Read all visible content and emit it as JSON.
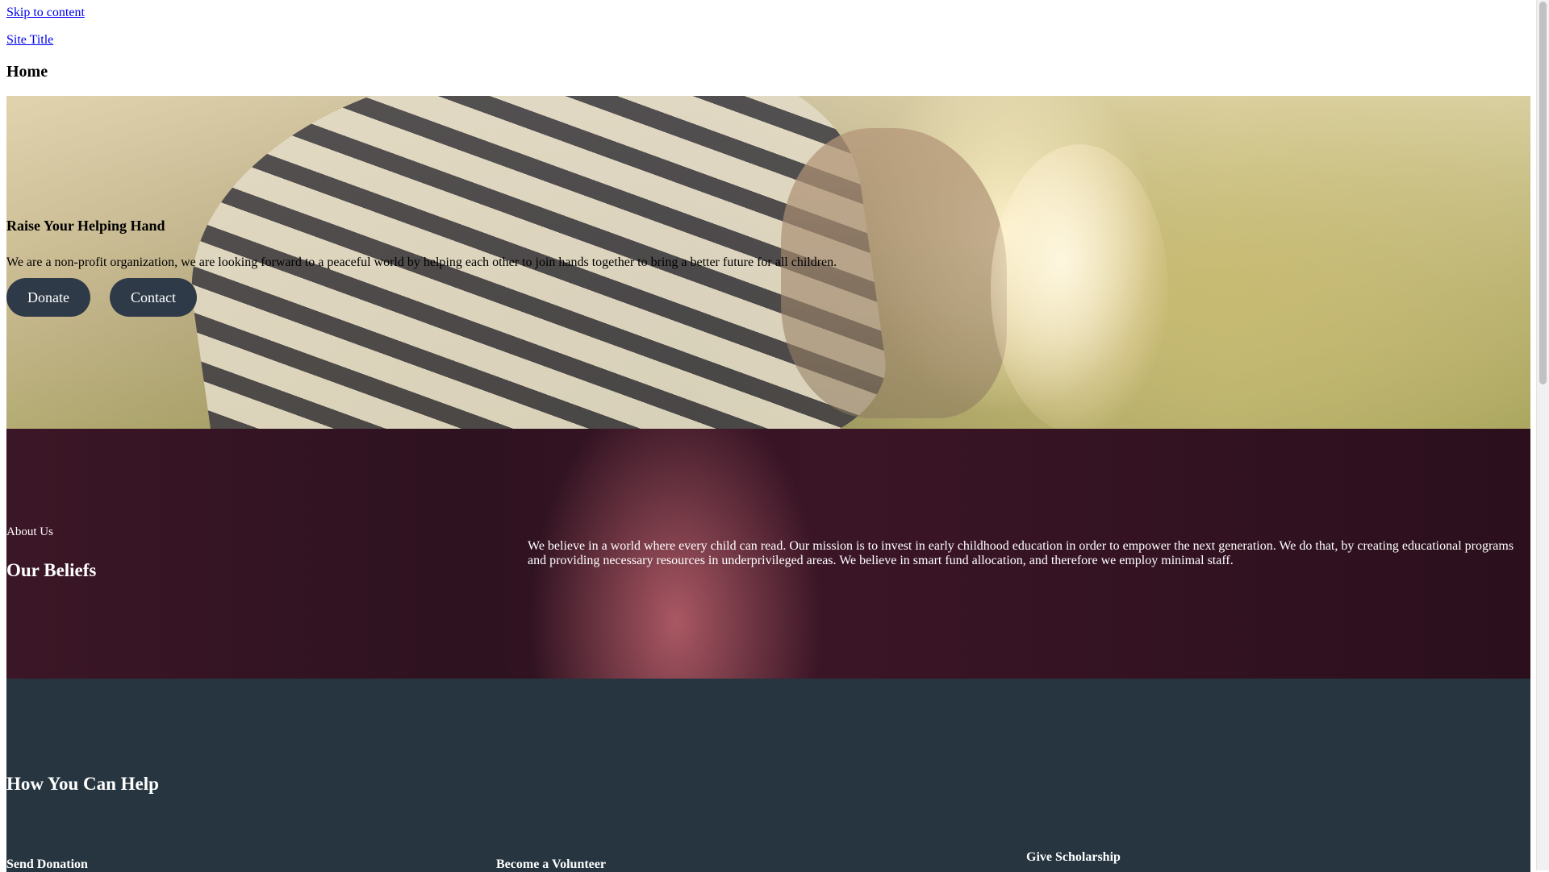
{
  "header": {
    "skip_link": "Skip to content",
    "site_title": "Site Title",
    "page_title": "Home"
  },
  "hero": {
    "heading": "Raise Your Helping Hand",
    "text": "We are a non-profit organization, we are looking forward to a peaceful world by helping each other to join hands together to bring a better future for all children.",
    "donate_label": "Donate",
    "contact_label": "Contact"
  },
  "beliefs": {
    "eyebrow": "About Us",
    "heading": "Our Beliefs",
    "text": "We believe in a world where every child can read. Our mission is to invest in early childhood education in order to empower the next generation. We do that, by creating educational programs and providing necessary resources in underprivileged areas. We believe in smart fund allocation, and therefore we employ minimal staff."
  },
  "help": {
    "heading": "How You Can Help",
    "items": [
      {
        "label": "Send Donation"
      },
      {
        "label": "Become a Volunteer"
      },
      {
        "label": "Give Scholarship"
      }
    ]
  },
  "colors": {
    "link": "#0000ee",
    "button_bg": "#2f3a48",
    "beliefs_bg": "#2e1220",
    "help_bg": "#263540"
  }
}
